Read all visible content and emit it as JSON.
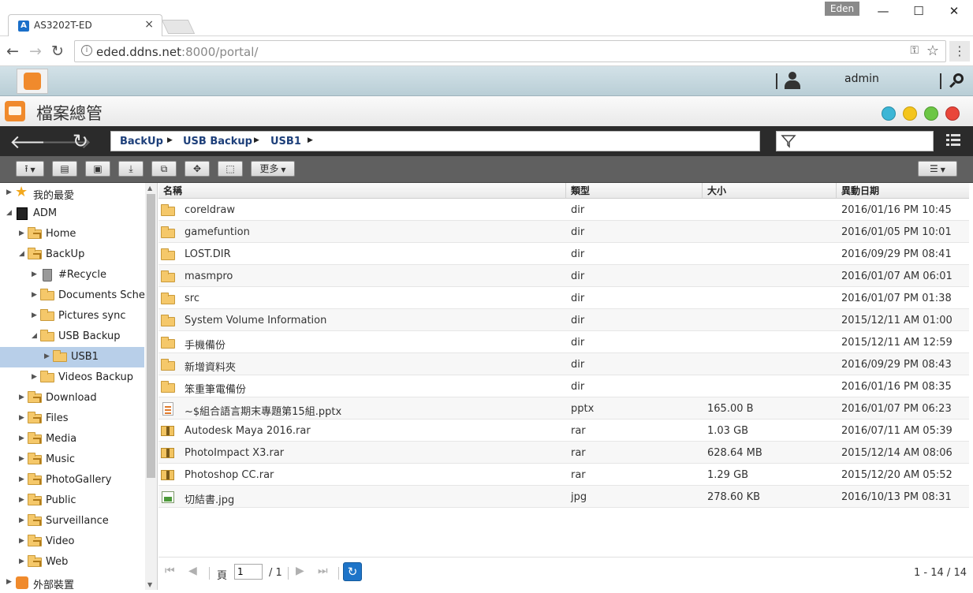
{
  "browser": {
    "tab_title": "AS3202T-ED",
    "tab_close": "×",
    "window_user": "Eden",
    "url_host": "eded.ddns.net",
    "url_rest": ":8000/portal/"
  },
  "portal": {
    "username": "admin"
  },
  "app": {
    "title": "檔案總管"
  },
  "breadcrumb": [
    "BackUp",
    "USB Backup",
    "USB1"
  ],
  "toolbar": {
    "more_label": "更多"
  },
  "tree": [
    {
      "label": "我的最愛",
      "level": 0,
      "icon": "star-icon",
      "expanded": false
    },
    {
      "label": "ADM",
      "level": 0,
      "icon": "nas-icon",
      "expanded": true
    },
    {
      "label": "Home",
      "level": 1,
      "icon": "share-folder-icon",
      "expanded": false
    },
    {
      "label": "BackUp",
      "level": 1,
      "icon": "share-folder-icon",
      "expanded": true
    },
    {
      "label": "#Recycle",
      "level": 2,
      "icon": "recycle-bin-icon",
      "expanded": false
    },
    {
      "label": "Documents Sched",
      "level": 2,
      "icon": "folder-icon",
      "expanded": false
    },
    {
      "label": "Pictures sync",
      "level": 2,
      "icon": "folder-icon",
      "expanded": false
    },
    {
      "label": "USB Backup",
      "level": 2,
      "icon": "folder-icon",
      "expanded": true
    },
    {
      "label": "USB1",
      "level": 3,
      "icon": "folder-icon",
      "expanded": false,
      "selected": true
    },
    {
      "label": "Videos Backup",
      "level": 2,
      "icon": "folder-icon",
      "expanded": false
    },
    {
      "label": "Download",
      "level": 1,
      "icon": "share-folder-icon",
      "expanded": false
    },
    {
      "label": "Files",
      "level": 1,
      "icon": "share-folder-icon",
      "expanded": false
    },
    {
      "label": "Media",
      "level": 1,
      "icon": "share-folder-icon",
      "expanded": false
    },
    {
      "label": "Music",
      "level": 1,
      "icon": "share-folder-icon",
      "expanded": false
    },
    {
      "label": "PhotoGallery",
      "level": 1,
      "icon": "share-folder-icon",
      "expanded": false
    },
    {
      "label": "Public",
      "level": 1,
      "icon": "share-folder-icon",
      "expanded": false
    },
    {
      "label": "Surveillance",
      "level": 1,
      "icon": "share-folder-icon",
      "expanded": false
    },
    {
      "label": "Video",
      "level": 1,
      "icon": "share-folder-icon",
      "expanded": false
    },
    {
      "label": "Web",
      "level": 1,
      "icon": "share-folder-icon",
      "expanded": false
    },
    {
      "label": "外部裝置",
      "level": 0,
      "icon": "external-device-icon",
      "expanded": false
    }
  ],
  "columns": [
    "名稱",
    "類型",
    "大小",
    "異動日期"
  ],
  "files": [
    {
      "name": "coreldraw",
      "type": "dir",
      "size": "",
      "modified": "2016/01/16 PM 10:45",
      "icon": "folder-icon"
    },
    {
      "name": "gamefuntion",
      "type": "dir",
      "size": "",
      "modified": "2016/01/05 PM 10:01",
      "icon": "folder-icon"
    },
    {
      "name": "LOST.DIR",
      "type": "dir",
      "size": "",
      "modified": "2016/09/29 PM 08:41",
      "icon": "folder-icon"
    },
    {
      "name": "masmpro",
      "type": "dir",
      "size": "",
      "modified": "2016/01/07 AM 06:01",
      "icon": "folder-icon"
    },
    {
      "name": "src",
      "type": "dir",
      "size": "",
      "modified": "2016/01/07 PM 01:38",
      "icon": "folder-icon"
    },
    {
      "name": "System Volume Information",
      "type": "dir",
      "size": "",
      "modified": "2015/12/11 AM 01:00",
      "icon": "folder-icon"
    },
    {
      "name": "手機備份",
      "type": "dir",
      "size": "",
      "modified": "2015/12/11 AM 12:59",
      "icon": "folder-icon"
    },
    {
      "name": "新增資料夾",
      "type": "dir",
      "size": "",
      "modified": "2016/09/29 PM 08:43",
      "icon": "folder-icon"
    },
    {
      "name": "笨重筆電備份",
      "type": "dir",
      "size": "",
      "modified": "2016/01/16 PM 08:35",
      "icon": "folder-icon"
    },
    {
      "name": "~$組合語言期末專題第15組.pptx",
      "type": "pptx",
      "size": "165.00 B",
      "modified": "2016/01/07 PM 06:23",
      "icon": "pptx-file-icon"
    },
    {
      "name": "Autodesk Maya 2016.rar",
      "type": "rar",
      "size": "1.03 GB",
      "modified": "2016/07/11 AM 05:39",
      "icon": "rar-file-icon"
    },
    {
      "name": "PhotoImpact X3.rar",
      "type": "rar",
      "size": "628.64 MB",
      "modified": "2015/12/14 AM 08:06",
      "icon": "rar-file-icon"
    },
    {
      "name": "Photoshop CC.rar",
      "type": "rar",
      "size": "1.29 GB",
      "modified": "2015/12/20 AM 05:52",
      "icon": "rar-file-icon"
    },
    {
      "name": "切結書.jpg",
      "type": "jpg",
      "size": "278.60 KB",
      "modified": "2016/10/13 PM 08:31",
      "icon": "jpg-file-icon"
    }
  ],
  "pager": {
    "page_label": "頁",
    "current_page": "1",
    "total_pages": "/ 1",
    "record_count": "1 - 14 / 14"
  }
}
